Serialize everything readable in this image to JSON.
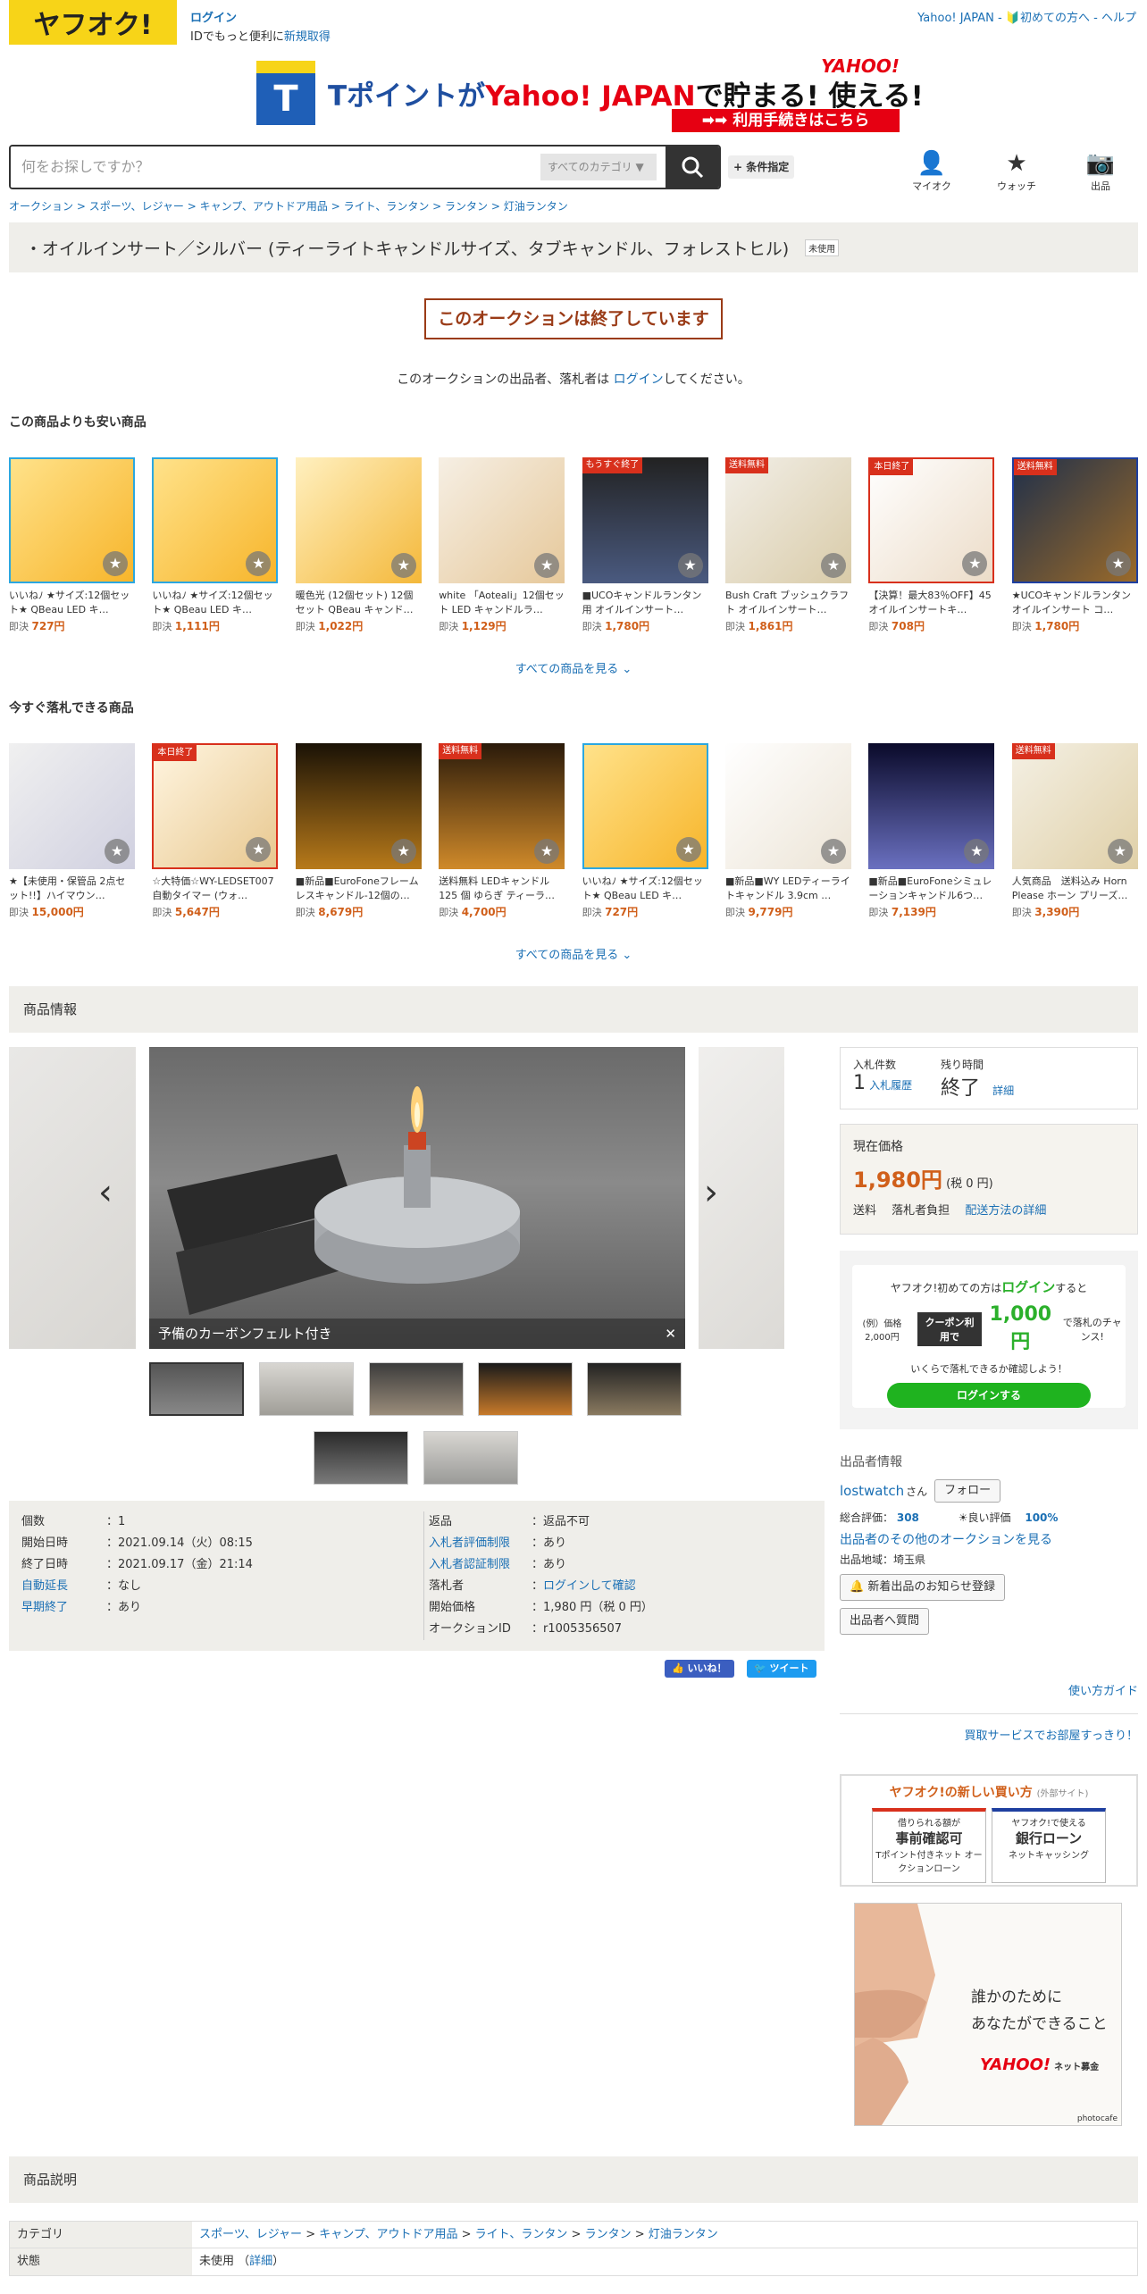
{
  "header": {
    "logo": "ヤフオク!",
    "login": "ログイン",
    "login_sub_prefix": "IDでもっと便利に",
    "register": "新規取得",
    "right_links": "Yahoo! JAPAN - 🔰初めての方へ - ヘルプ"
  },
  "banner": {
    "t_label": "T",
    "text_a": "Tポイントが",
    "text_b": "Yahoo! JAPAN",
    "text_c": "で貯まる! 使える!",
    "brand": "YAHOO!",
    "button": "➡➡ 利用手続きはこちら"
  },
  "search": {
    "placeholder": "何をお探しですか？",
    "category": "すべてのカテゴリ",
    "condition_button": "+ 条件指定"
  },
  "nav": {
    "myauc": "マイオク",
    "watch": "ウォッチ",
    "sell": "出品"
  },
  "breadcrumb": [
    "オークション",
    "スポーツ、レジャー",
    "キャンプ、アウトドア用品",
    "ライト、ランタン",
    "ランタン",
    "灯油ランタン"
  ],
  "title": {
    "text": "・オイルインサート／シルバー (ティーライトキャンドルサイズ、タブキャンドル、フォレストヒル)",
    "badge": "未使用"
  },
  "ended": {
    "message": "このオークションは終了しています",
    "notice_a": "このオークションの出品者、落札者は",
    "notice_link": "ログイン",
    "notice_b": "してください。"
  },
  "cheaper": {
    "heading": "この商品よりも安い商品",
    "more": "すべての商品を見る",
    "items": [
      {
        "name": "いいねﾉ ★サイズ:12個セット★ QBeau LED キ…",
        "price_label": "即決",
        "price": "727円",
        "tag": "",
        "frame": "#2ba7e0"
      },
      {
        "name": "いいねﾉ ★サイズ:12個セット★ QBeau LED キ…",
        "price_label": "即決",
        "price": "1,111円",
        "tag": "",
        "frame": "#2ba7e0"
      },
      {
        "name": "暖色光 (12個セット) 12個セット QBeau キャンド…",
        "price_label": "即決",
        "price": "1,022円",
        "tag": "",
        "frame": ""
      },
      {
        "name": "white 「Aoteali」12個セット LED キャンドルラ…",
        "price_label": "即決",
        "price": "1,129円",
        "tag": "",
        "frame": ""
      },
      {
        "name": "■UCOキャンドルランタン用 オイルインサート…",
        "price_label": "即決",
        "price": "1,780円",
        "tag": "もうすぐ終了",
        "frame": ""
      },
      {
        "name": "Bush Craft ブッシュクラフト オイルインサート…",
        "price_label": "即決",
        "price": "1,861円",
        "tag": "送料無料",
        "frame": ""
      },
      {
        "name": "【決算！最大83％OFF】45 オイルインサートキ…",
        "price_label": "即決",
        "price": "708円",
        "tag": "本日終了",
        "frame": "#d8301c"
      },
      {
        "name": "★UCOキャンドルランタン オイルインサート コ…",
        "price_label": "即決",
        "price": "1,780円",
        "tag": "送料無料",
        "frame": "#1e3fa0"
      }
    ]
  },
  "buynow": {
    "heading": "今すぐ落札できる商品",
    "more": "すべての商品を見る",
    "items": [
      {
        "name": "★【未使用・保管品 2点セット!!】ハイマウン…",
        "price_label": "即決",
        "price": "15,000円",
        "tag": "",
        "frame": ""
      },
      {
        "name": "☆大特価☆WY-LEDSET007 自動タイマー (ウォ…",
        "price_label": "即決",
        "price": "5,647円",
        "tag": "本日終了",
        "frame": "#d8301c"
      },
      {
        "name": "■新品■EuroFoneフレームレスキャンドル-12個の…",
        "price_label": "即決",
        "price": "8,679円",
        "tag": "",
        "frame": ""
      },
      {
        "name": "送料無料 LEDキャンドル 125 個 ゆらぎ ティーラ…",
        "price_label": "即決",
        "price": "4,700円",
        "tag": "送料無料",
        "frame": ""
      },
      {
        "name": "いいねﾉ ★サイズ:12個セット★ QBeau LED キ…",
        "price_label": "即決",
        "price": "727円",
        "tag": "",
        "frame": "#2ba7e0"
      },
      {
        "name": "■新品■WY LEDティーライトキャンドル 3.9cm …",
        "price_label": "即決",
        "price": "9,779円",
        "tag": "",
        "frame": ""
      },
      {
        "name": "■新品■EuroFoneシミュレーションキャンドル6つ…",
        "price_label": "即決",
        "price": "7,139円",
        "tag": "",
        "frame": ""
      },
      {
        "name": "人気商品　送料込み Horn Please ホーン プリーズ…",
        "price_label": "即決",
        "price": "3,390円",
        "tag": "送料無料",
        "frame": ""
      }
    ]
  },
  "product_info": {
    "heading": "商品情報",
    "caption": "予備のカーボンフェルト付き"
  },
  "details_left": [
    {
      "k": "個数",
      "v": "1",
      "link": false
    },
    {
      "k": "開始日時",
      "v": "2021.09.14（火）08:15",
      "link": false
    },
    {
      "k": "終了日時",
      "v": "2021.09.17（金）21:14",
      "link": false
    },
    {
      "k": "自動延長",
      "v": "なし",
      "link": true
    },
    {
      "k": "早期終了",
      "v": "あり",
      "link": true
    }
  ],
  "details_right": [
    {
      "k": "返品",
      "v": "返品不可",
      "link": false,
      "vlink": false
    },
    {
      "k": "入札者評価制限",
      "v": "あり",
      "link": true,
      "vlink": false
    },
    {
      "k": "入札者認証制限",
      "v": "あり",
      "link": true,
      "vlink": false
    },
    {
      "k": "落札者",
      "v": "ログインして確認",
      "link": false,
      "vlink": true
    },
    {
      "k": "開始価格",
      "v": "1,980 円（税 0 円）",
      "link": false,
      "vlink": false
    },
    {
      "k": "オークションID",
      "v": "r1005356507",
      "link": false,
      "vlink": false
    }
  ],
  "social": {
    "like": "👍 いいね！",
    "tweet": "🐦 ツイート"
  },
  "bid": {
    "count_label": "入札件数",
    "count": "1",
    "history": "入札履歴",
    "remain_label": "残り時間",
    "remain": "終了",
    "detail": "詳細"
  },
  "price": {
    "label": "現在価格",
    "value": "1,980円",
    "tax": "(税 0 円)",
    "ship_label": "送料",
    "ship_value": "落札者負担",
    "ship_link": "配送方法の詳細"
  },
  "login_promo": {
    "line1_a": "ヤフオク!初めての方は",
    "line1_link": "ログイン",
    "line1_b": "すると",
    "example": "(例）価格2,000円",
    "coupon": "クーポン利用で",
    "amount": "1,000円",
    "amount_sub": "で落札のチャンス!",
    "line3": "いくらで落札できるか確認しよう！",
    "button": "ログインする"
  },
  "seller": {
    "heading": "出品者情報",
    "name": "lostwatch",
    "suffix": "さん",
    "follow": "フォロー",
    "rating_label": "総合評価：",
    "rating": "308",
    "good_label": "良い評価",
    "good": "100%",
    "other_link": "出品者のその他のオークションを見る",
    "region": "出品地域：埼玉県",
    "notify": "🔔 新着出品のお知らせ登録",
    "question": "出品者へ質問"
  },
  "guide": {
    "usage": "使い方ガイド",
    "buy_service": "買取サービスでお部屋すっきり！"
  },
  "new_way": {
    "title": "ヤフオク!の新しい買い方",
    "external": "(外部サイト)",
    "card1_top": "借りられる額が",
    "card1_main": "事前確認可",
    "card1_sub": "Tポイント付きネット オークションローン",
    "card2_top": "ヤフオク!で使える",
    "card2_main": "銀行ローン",
    "card2_sub": "ネットキャッシング"
  },
  "ad": {
    "line1": "誰かのために",
    "line2": "あなたができること",
    "brand": "YAHOO!",
    "brand_sub": "ネット募金",
    "credit": "photocafe"
  },
  "description": {
    "heading": "商品説明",
    "category_label": "カテゴリ",
    "category_path": [
      "スポーツ、レジャー",
      "キャンプ、アウトドア用品",
      "ライト、ランタン",
      "ランタン",
      "灯油ランタン"
    ],
    "condition_label": "状態",
    "condition": "未使用",
    "condition_link": "詳細"
  },
  "colors": {
    "accent": "#1a6fb4",
    "price": "#d05f1a",
    "ended": "#9a3b17",
    "brand_yellow": "#f7d418"
  }
}
